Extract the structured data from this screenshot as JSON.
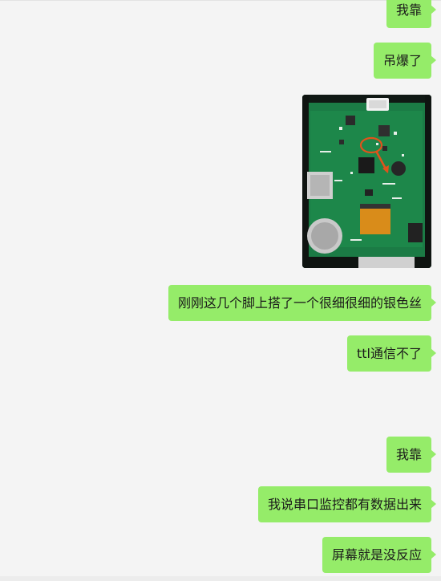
{
  "chat": {
    "messages": [
      {
        "type": "text",
        "text": "我靠"
      },
      {
        "type": "text",
        "text": "吊爆了"
      },
      {
        "type": "image",
        "image": "pcb-photo"
      },
      {
        "type": "text",
        "text": "刚刚这几个脚上搭了一个很细很细的银色丝"
      },
      {
        "type": "text",
        "text": "ttl通信不了"
      },
      {
        "type": "text",
        "text": "我靠"
      },
      {
        "type": "text",
        "text": "我说串口监控都有数据出来"
      },
      {
        "type": "text",
        "text": "屏幕就是没反应"
      }
    ]
  },
  "colors": {
    "bubble": "#95ec69",
    "background": "#f4f4f4",
    "text": "#1a1a1a",
    "annotation": "#e0531c"
  }
}
